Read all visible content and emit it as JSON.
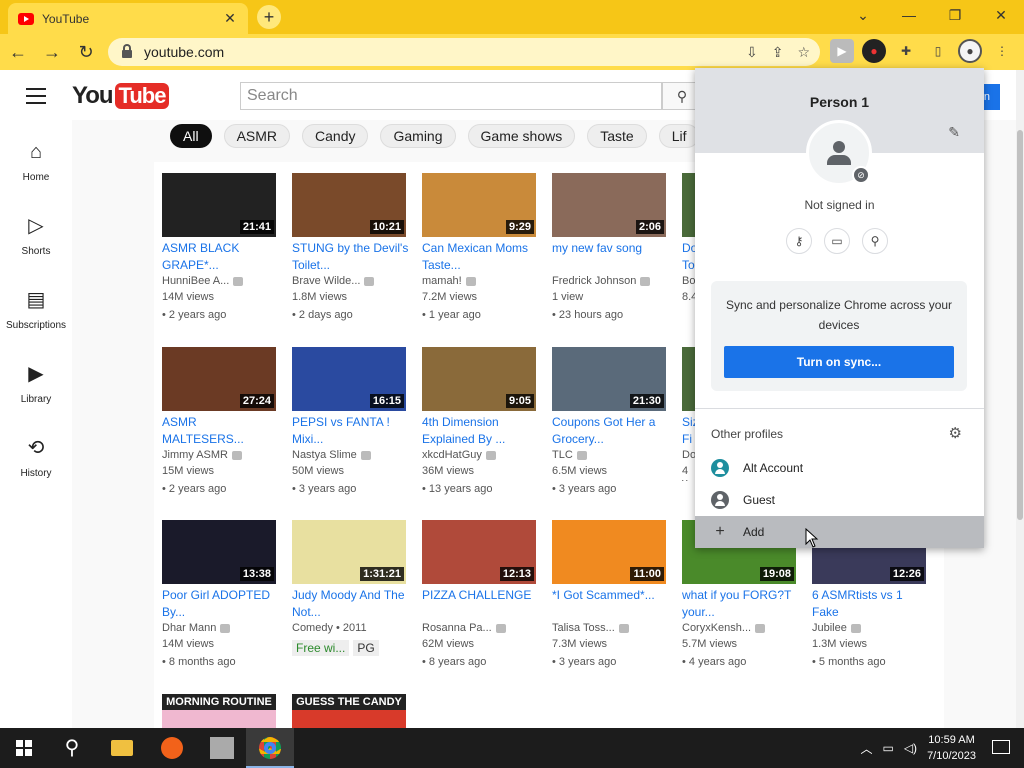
{
  "browser": {
    "tab_title": "YouTube",
    "url": "youtube.com",
    "new_tab": "+",
    "close": "✕"
  },
  "yt": {
    "search_placeholder": "Search",
    "logo_you": "You",
    "logo_tube": "Tube",
    "signin_label": "n",
    "sidebar": [
      {
        "label": "Home",
        "icon": "home-icon"
      },
      {
        "label": "Shorts",
        "icon": "shorts-icon"
      },
      {
        "label": "Subscriptions",
        "icon": "subscriptions-icon"
      },
      {
        "label": "Library",
        "icon": "library-icon"
      },
      {
        "label": "History",
        "icon": "history-icon"
      }
    ],
    "chips": [
      "All",
      "ASMR",
      "Candy",
      "Gaming",
      "Game shows",
      "Taste",
      "Lif"
    ],
    "videos": [
      {
        "title": "ASMR BLACK GRAPE*...",
        "channel": "HunniBee A...",
        "views": "14M views",
        "age": "2 years ago",
        "duration": "21:41",
        "color": "#222"
      },
      {
        "title": "STUNG by the Devil's Toilet...",
        "channel": "Brave Wilde...",
        "views": "1.8M views",
        "age": "2 days ago",
        "duration": "10:21",
        "color": "#7a4a2a"
      },
      {
        "title": "Can Mexican Moms Taste...",
        "channel": "mamah!",
        "views": "7.2M views",
        "age": "1 year ago",
        "duration": "9:29",
        "color": "#c98a3a"
      },
      {
        "title": "my new fav song",
        "channel": "Fredrick Johnson",
        "views": "1 view",
        "age": "23 hours ago",
        "duration": "2:06",
        "color": "#8a6a5a"
      },
      {
        "title": "ASMR MALTESERS...",
        "channel": "Jimmy ASMR",
        "views": "15M views",
        "age": "2 years ago",
        "duration": "27:24",
        "color": "#6b3a24"
      },
      {
        "title": "PEPSI vs FANTA ! Mixi...",
        "channel": "Nastya Slime",
        "views": "50M views",
        "age": "3 years ago",
        "duration": "16:15",
        "color": "#2a4aa0"
      },
      {
        "title": "4th Dimension Explained By ...",
        "channel": "xkcdHatGuy",
        "views": "36M views",
        "age": "13 years ago",
        "duration": "9:05",
        "color": "#8a6a3a"
      },
      {
        "title": "Coupons Got Her a Grocery...",
        "channel": "TLC",
        "views": "6.5M views",
        "age": "3 years ago",
        "duration": "21:30",
        "color": "#5a6a7a"
      },
      {
        "title": "Poor Girl ADOPTED By...",
        "channel": "Dhar Mann",
        "views": "14M views",
        "age": "8 months ago",
        "duration": "13:38",
        "color": "#1a1a2a"
      },
      {
        "title": "Judy Moody And The Not...",
        "channel": "Comedy • 2011",
        "views": "",
        "age": "",
        "duration": "1:31:21",
        "color": "#e8e0a0"
      },
      {
        "title": "PIZZA CHALLENGE",
        "channel": "Rosanna Pa...",
        "views": "62M views",
        "age": "8 years ago",
        "duration": "12:13",
        "color": "#b04a3a"
      },
      {
        "title": "*I Got Scammed*...",
        "channel": "Talisa Toss...",
        "views": "7.3M views",
        "age": "3 years ago",
        "duration": "11:00",
        "color": "#f08a20"
      },
      {
        "title": "what if you FORG?T your...",
        "channel": "CoryxKensh...",
        "views": "5.7M views",
        "age": "4 years ago",
        "duration": "19:08",
        "color": "#4a8a2a"
      },
      {
        "title": "6 ASMRtists vs 1 Fake",
        "channel": "Jubilee",
        "views": "1.3M views",
        "age": "5 months ago",
        "duration": "12:26",
        "color": "#3a3a5a"
      }
    ],
    "partial_col": [
      {
        "t1": "Do",
        "t2": "To",
        "ch": "Bo",
        "v": "8.4"
      },
      {
        "t1": "Siz",
        "t2": "Fi",
        "ch": "Do",
        "v": "4 v"
      }
    ],
    "judy_badges": [
      "Free wi...",
      "PG"
    ],
    "bottom_thumb_2": "GUESS THE CANDY",
    "bottom_thumb_1": "MORNING ROUTINE"
  },
  "popup": {
    "name": "Person 1",
    "status": "Not signed in",
    "sync_text": "Sync and personalize Chrome across your devices",
    "sync_button": "Turn on sync...",
    "other_profiles": "Other profiles",
    "profiles": [
      {
        "label": "Alt Account",
        "color": "#1e8e9e"
      },
      {
        "label": "Guest",
        "color": "#5f6368"
      }
    ],
    "add": "Add"
  },
  "taskbar": {
    "time": "10:59 AM",
    "date": "7/10/2023"
  }
}
